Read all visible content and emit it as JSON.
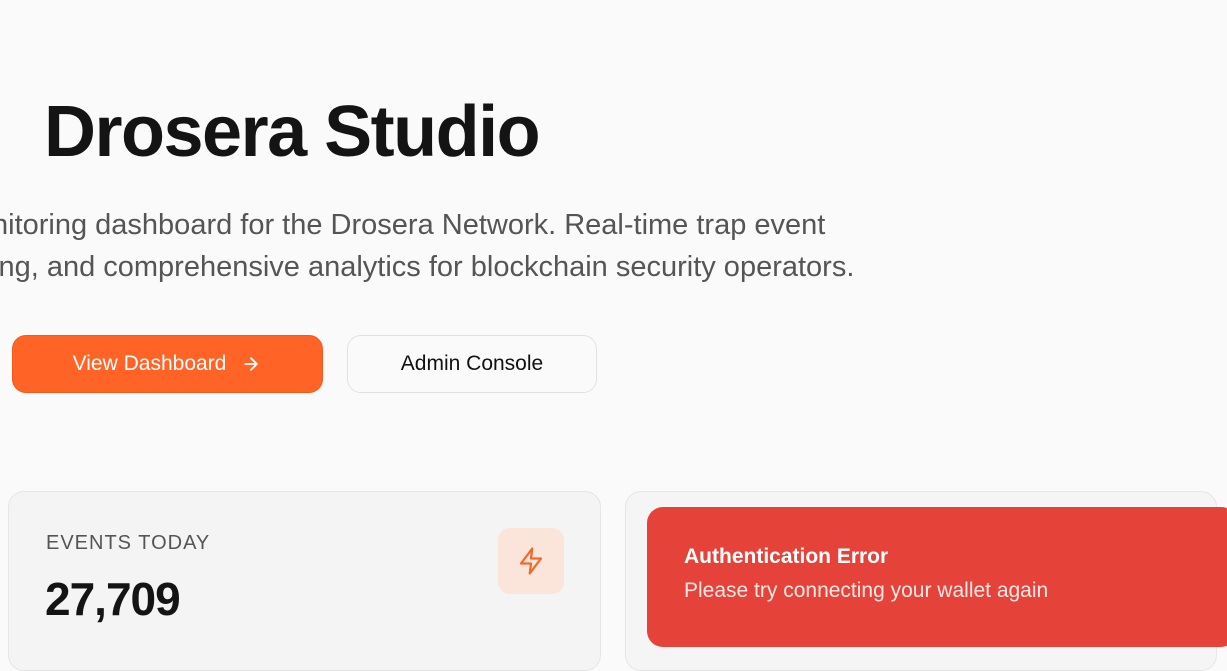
{
  "hero": {
    "title": "Drosera Studio",
    "description_line1": "nitoring dashboard for the Drosera Network. Real-time trap event",
    "description_line2": "ing, and comprehensive analytics for blockchain security operators."
  },
  "actions": {
    "primary_label": "View Dashboard",
    "primary_icon": "arrow-right-icon",
    "secondary_label": "Admin Console"
  },
  "stats": {
    "events_today": {
      "label": "EVENTS TODAY",
      "value": "27,709",
      "icon": "lightning-bolt-icon"
    }
  },
  "toast": {
    "title": "Authentication Error",
    "message": "Please try connecting your wallet again"
  },
  "colors": {
    "accent": "#ff6426",
    "error": "#e5433a",
    "background": "#fafafa"
  }
}
